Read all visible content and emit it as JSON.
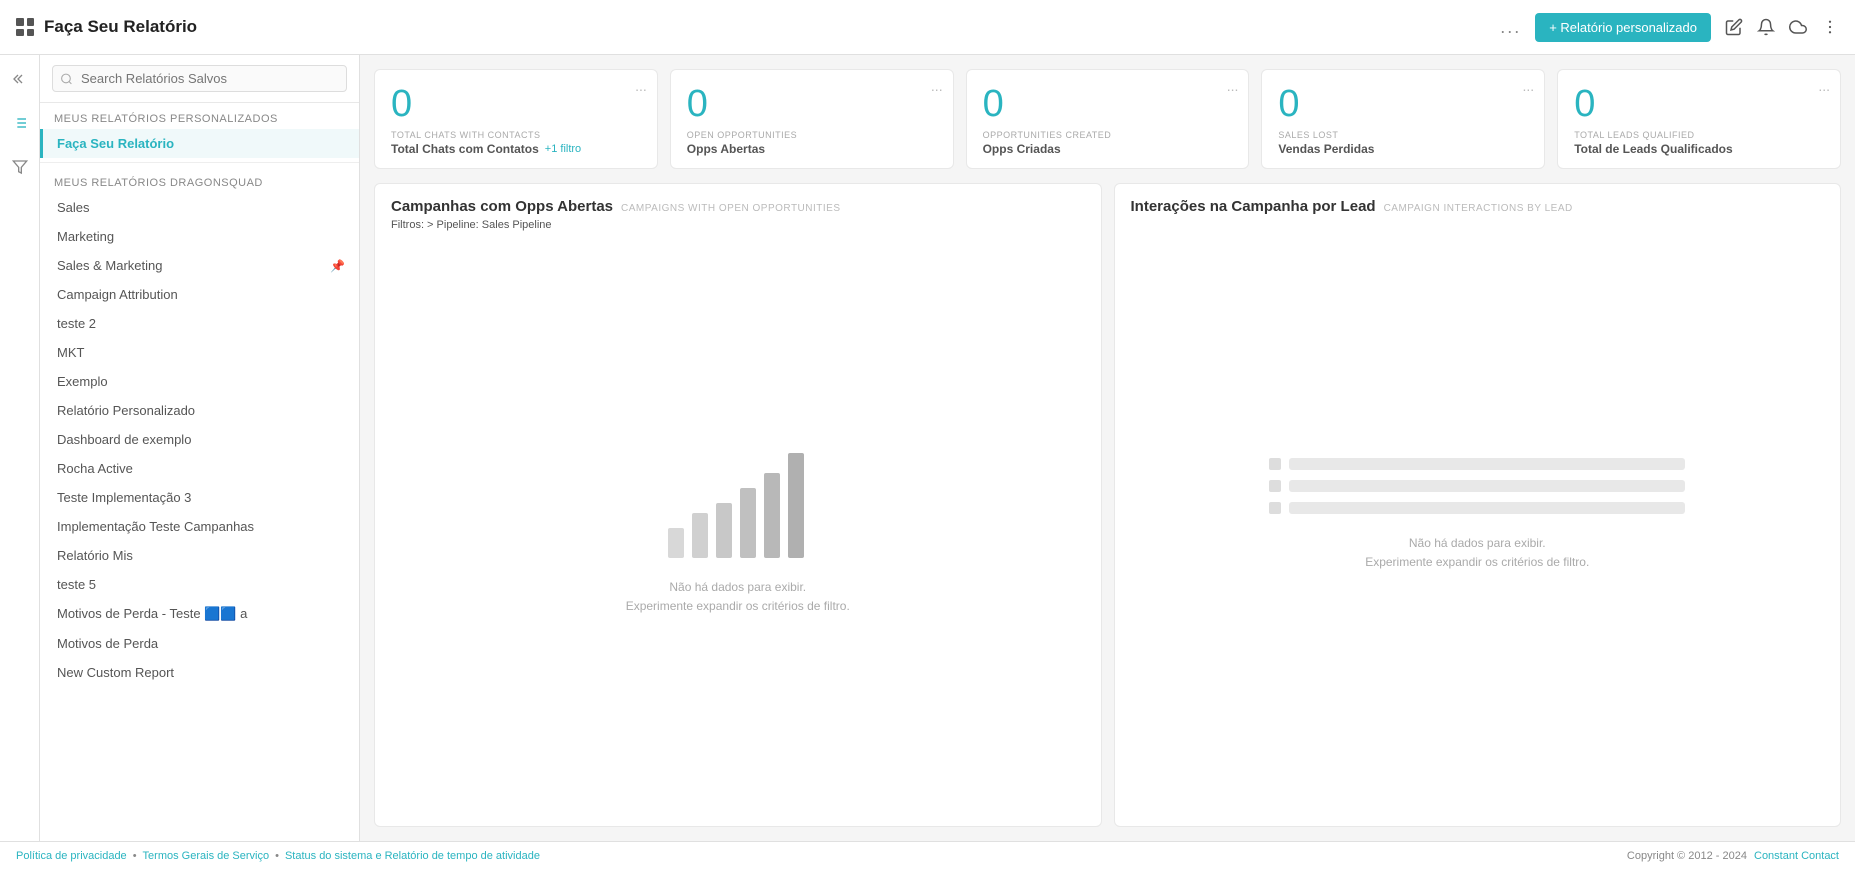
{
  "header": {
    "title": "Faça Seu Relatório",
    "dots": "...",
    "btn_new_report": "+ Relatório personalizado"
  },
  "search": {
    "placeholder": "Search Relatórios Salvos"
  },
  "sidebar": {
    "my_reports_label": "Meus relatórios personalizados",
    "active_report": "Faça Seu Relatório",
    "section_label": "MEUS RELATÓRIOS DRAGONSQUAD",
    "items": [
      {
        "label": "Sales",
        "pinned": false
      },
      {
        "label": "Marketing",
        "pinned": false
      },
      {
        "label": "Sales & Marketing",
        "pinned": true
      },
      {
        "label": "Campaign Attribution",
        "pinned": false
      },
      {
        "label": "teste 2",
        "pinned": false
      },
      {
        "label": "MKT",
        "pinned": false
      },
      {
        "label": "Exemplo",
        "pinned": false
      },
      {
        "label": "Relatório Personalizado",
        "pinned": false
      },
      {
        "label": "Dashboard de exemplo",
        "pinned": false
      },
      {
        "label": "Rocha Active",
        "pinned": false
      },
      {
        "label": "Teste Implementação 3",
        "pinned": false
      },
      {
        "label": "Implementação Teste Campanhas",
        "pinned": false
      },
      {
        "label": "Relatório Mis",
        "pinned": false
      },
      {
        "label": "teste 5",
        "pinned": false
      },
      {
        "label": "Motivos de Perda - Teste 🟦🟦 a",
        "pinned": false
      },
      {
        "label": "Motivos de Perda",
        "pinned": false
      },
      {
        "label": "New Custom Report",
        "pinned": false
      }
    ]
  },
  "metrics": [
    {
      "value": "0",
      "key": "TOTAL CHATS WITH CONTACTS",
      "label": "Total Chats com Contatos",
      "filter": "+1 filtro",
      "dots": "..."
    },
    {
      "value": "0",
      "key": "OPEN OPPORTUNITIES",
      "label": "Opps Abertas",
      "filter": "",
      "dots": "..."
    },
    {
      "value": "0",
      "key": "OPPORTUNITIES CREATED",
      "label": "Opps Criadas",
      "filter": "",
      "dots": "..."
    },
    {
      "value": "0",
      "key": "SALES LOST",
      "label": "Vendas Perdidas",
      "filter": "",
      "dots": "..."
    },
    {
      "value": "0",
      "key": "TOTAL LEADS QUALIFIED",
      "label": "Total de Leads Qualificados",
      "filter": "",
      "dots": "..."
    }
  ],
  "chart_left": {
    "title": "Campanhas com Opps Abertas",
    "subtitle": "CAMPAIGNS WITH OPEN OPPORTUNITIES",
    "filter_label": "Filtros: > Pipeline:",
    "filter_value": "Sales Pipeline",
    "no_data_line1": "Não há dados para exibir.",
    "no_data_line2": "Experimente expandir os critérios de filtro."
  },
  "chart_right": {
    "title": "Interações na Campanha por Lead",
    "subtitle": "CAMPAIGN INTERACTIONS BY LEAD",
    "no_data_line1": "Não há dados para exibir.",
    "no_data_line2": "Experimente expandir os critérios de filtro."
  },
  "footer": {
    "privacy": "Política de privacidade",
    "terms": "Termos Gerais de Serviço",
    "status": "Status do sistema e Relatório de tempo de atividade",
    "copyright": "Copyright © 2012 - 2024",
    "brand": "Constant Contact"
  }
}
